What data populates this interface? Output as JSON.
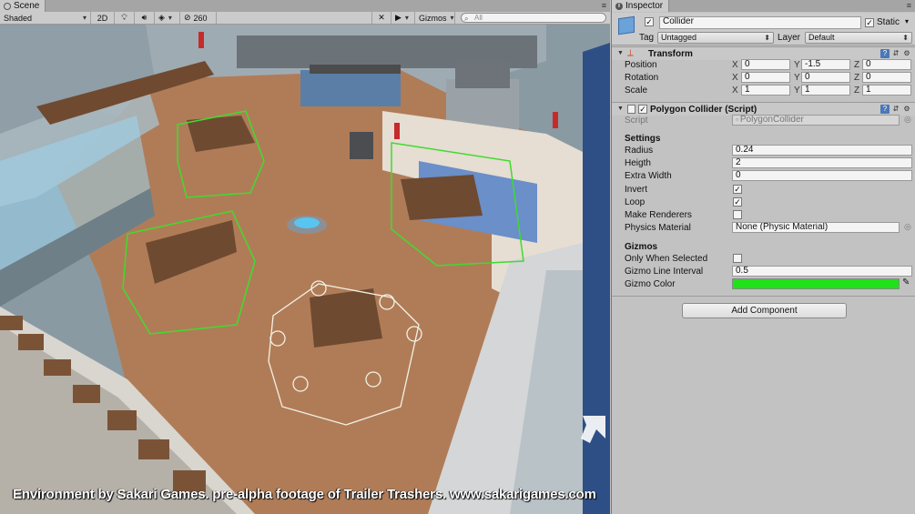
{
  "scene": {
    "tab_label": "Scene",
    "toolbar": {
      "shading_mode": "Shaded",
      "mode_2d": "2D",
      "hidden_count": "260",
      "gizmos_label": "Gizmos",
      "search_placeholder": "All"
    },
    "caption": "Environment by Sakari Games. pre-alpha footage of Trailer Trashers. www.sakarigames.com"
  },
  "inspector": {
    "tab_label": "Inspector",
    "object": {
      "active": true,
      "name": "Collider",
      "static_checked": true,
      "static_label": "Static",
      "tag_label": "Tag",
      "tag_value": "Untagged",
      "layer_label": "Layer",
      "layer_value": "Default"
    },
    "transform": {
      "title": "Transform",
      "rows": [
        {
          "label": "Position",
          "x": "0",
          "y": "-1.5",
          "z": "0"
        },
        {
          "label": "Rotation",
          "x": "0",
          "y": "0",
          "z": "0"
        },
        {
          "label": "Scale",
          "x": "1",
          "y": "1",
          "z": "1"
        }
      ],
      "axis_x": "X",
      "axis_y": "Y",
      "axis_z": "Z"
    },
    "polygon_collider": {
      "title": "Polygon Collider (Script)",
      "enabled": true,
      "script_label": "Script",
      "script_value": "PolygonCollider",
      "settings_header": "Settings",
      "radius_label": "Radius",
      "radius_value": "0.24",
      "height_label": "Heigth",
      "height_value": "2",
      "extra_width_label": "Extra Width",
      "extra_width_value": "0",
      "invert_label": "Invert",
      "invert_checked": true,
      "loop_label": "Loop",
      "loop_checked": true,
      "make_renderers_label": "Make Renderers",
      "make_renderers_checked": false,
      "physics_material_label": "Physics Material",
      "physics_material_value": "None (Physic Material)",
      "gizmos_header": "Gizmos",
      "only_selected_label": "Only When Selected",
      "only_selected_checked": false,
      "line_interval_label": "Gizmo Line Interval",
      "line_interval_value": "0.5",
      "gizmo_color_label": "Gizmo Color",
      "gizmo_color": "#1fe21a"
    },
    "add_component_label": "Add Component"
  }
}
